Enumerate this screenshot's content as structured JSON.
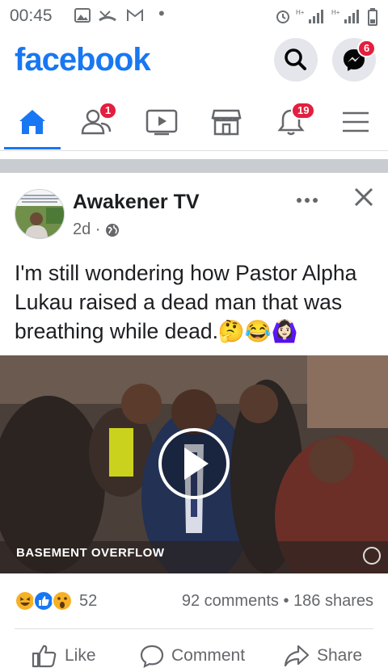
{
  "status_bar": {
    "time": "00:45"
  },
  "header": {
    "logo": "facebook",
    "messenger_badge": "6"
  },
  "nav": {
    "friends_badge": "1",
    "notifications_badge": "19"
  },
  "post": {
    "author": "Awakener TV",
    "time": "2d ·",
    "text": "I'm still wondering how Pastor Alpha Lukau raised a dead man that was breathing while dead.🤔😂🙆🏻‍♀️",
    "video_caption": "BASEMENT OVERFLOW",
    "reaction_count": "52",
    "comments": "92 comments",
    "shares": "186 shares",
    "actions": {
      "like": "Like",
      "comment": "Comment",
      "share": "Share"
    }
  },
  "colors": {
    "brand": "#1877f2",
    "badge": "#e41e3f"
  }
}
